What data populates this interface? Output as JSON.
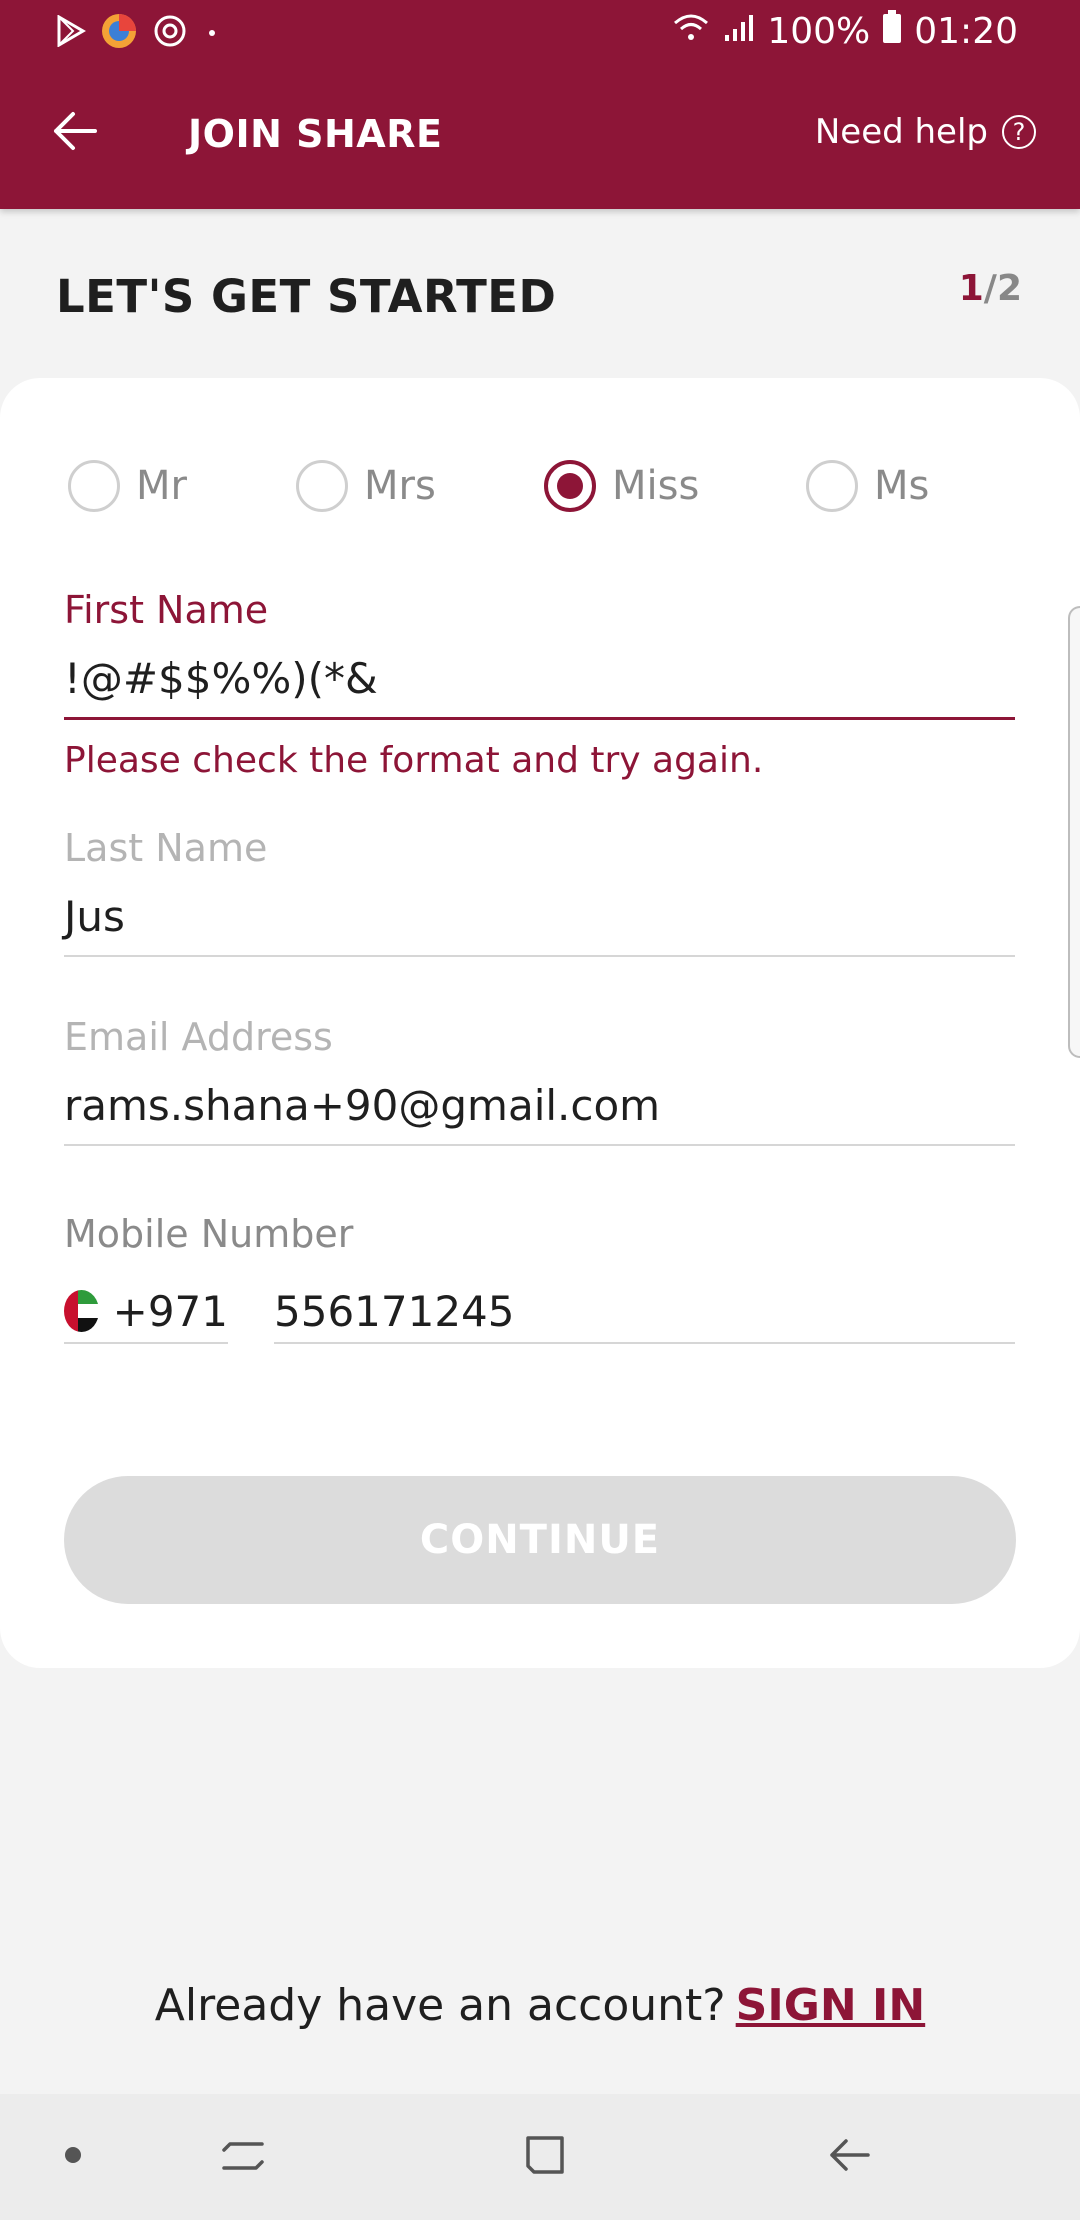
{
  "status_bar": {
    "battery": "100%",
    "time": "01:20",
    "icons": [
      "play-store-icon",
      "browser-icon",
      "sync-icon",
      "dot-icon",
      "wifi-icon",
      "signal-icon",
      "battery-icon"
    ]
  },
  "header": {
    "title": "JOIN SHARE",
    "help_label": "Need help",
    "help_icon_glyph": "?",
    "background": "#8d1537"
  },
  "page": {
    "heading": "LET'S GET STARTED",
    "step_current": "1",
    "step_total": "/2"
  },
  "title_options": [
    {
      "label": "Mr",
      "selected": false
    },
    {
      "label": "Mrs",
      "selected": false
    },
    {
      "label": "Miss",
      "selected": true
    },
    {
      "label": "Ms",
      "selected": false
    }
  ],
  "form": {
    "first_name": {
      "label": "First Name",
      "value": "!@#$$%%)(*&",
      "error": "Please check the format and try again."
    },
    "last_name": {
      "label": "Last Name",
      "value": "Jus"
    },
    "email": {
      "label": "Email Address",
      "value": "rams.shana+90@gmail.com"
    },
    "mobile": {
      "label": "Mobile Number",
      "country_code": "+971",
      "number": "556171245",
      "flag_icon": "uae-flag-icon"
    }
  },
  "buttons": {
    "continue": "CONTINUE"
  },
  "footer": {
    "prompt": "Already have an account?",
    "sign_in": "SIGN IN"
  },
  "colors": {
    "accent": "#8d1537",
    "disabled_button": "#dcdcdc"
  }
}
